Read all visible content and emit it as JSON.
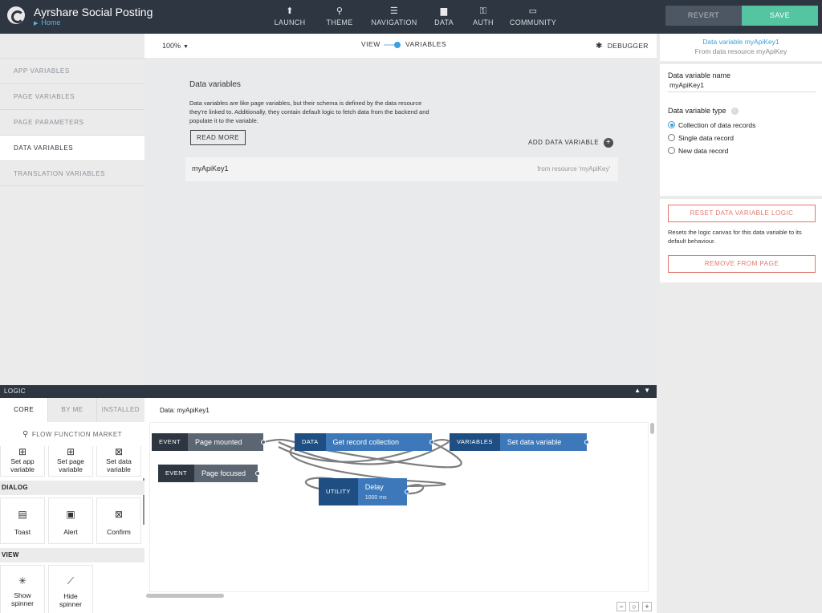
{
  "app": {
    "title": "Ayrshare Social Posting",
    "breadcrumb": "Home"
  },
  "topnav": [
    {
      "label": "LAUNCH",
      "icon": "launch-icon",
      "glyph": "⬆"
    },
    {
      "label": "THEME",
      "icon": "theme-icon",
      "glyph": "⚲"
    },
    {
      "label": "NAVIGATION",
      "icon": "navigation-icon",
      "glyph": "☰"
    },
    {
      "label": "DATA",
      "icon": "data-icon",
      "glyph": "▆"
    },
    {
      "label": "AUTH",
      "icon": "auth-icon",
      "glyph": "⚿"
    },
    {
      "label": "COMMUNITY",
      "icon": "community-icon",
      "glyph": "▭"
    }
  ],
  "actions": {
    "revert": "REVERT",
    "save": "SAVE"
  },
  "sidebar": {
    "items": [
      {
        "label": "APP VARIABLES",
        "active": false
      },
      {
        "label": "PAGE VARIABLES",
        "active": false
      },
      {
        "label": "PAGE PARAMETERS",
        "active": false
      },
      {
        "label": "DATA VARIABLES",
        "active": true
      },
      {
        "label": "TRANSLATION VARIABLES",
        "active": false
      }
    ]
  },
  "toolbar": {
    "zoom": "100%",
    "view_label": "VIEW",
    "variables_label": "VARIABLES",
    "debugger_label": "DEBUGGER"
  },
  "canvas": {
    "title": "Data variables",
    "description": "Data variables are like page variables, but their schema is defined by the data resource they're linked to. Additionally, they contain default logic to fetch data from the backend and populate it to the variable.",
    "read_more": "READ MORE",
    "add_label": "ADD DATA VARIABLE",
    "rows": [
      {
        "name": "myApiKey1",
        "source": "from resource 'myApiKey'"
      }
    ]
  },
  "properties": {
    "header_title": "Data variable myApiKey1",
    "header_sub": "From data resource myApiKey",
    "name_label": "Data variable name",
    "name_value": "myApiKey1",
    "type_label": "Data variable type",
    "type_options": [
      {
        "label": "Collection of data records",
        "selected": true
      },
      {
        "label": "Single data record",
        "selected": false
      },
      {
        "label": "New data record",
        "selected": false
      }
    ],
    "reset_label": "RESET DATA VARIABLE LOGIC",
    "reset_desc": "Resets the logic canvas for this data variable to its default behaviour.",
    "remove_label": "REMOVE FROM PAGE"
  },
  "logic": {
    "bar_title": "LOGIC",
    "tabs": [
      "CORE",
      "BY ME",
      "INSTALLED"
    ],
    "market_label": "FLOW FUNCTION MARKET",
    "variables_tiles": [
      {
        "label_1": "Set app",
        "label_2": "variable",
        "icon": "set-app-variable-icon"
      },
      {
        "label_1": "Set page",
        "label_2": "variable",
        "icon": "set-page-variable-icon"
      },
      {
        "label_1": "Set data",
        "label_2": "variable",
        "icon": "set-data-variable-icon"
      }
    ],
    "dialog_title": "DIALOG",
    "dialog_tiles": [
      {
        "label": "Toast",
        "icon": "toast-icon"
      },
      {
        "label": "Alert",
        "icon": "alert-icon"
      },
      {
        "label": "Confirm",
        "icon": "confirm-icon"
      }
    ],
    "view_title": "VIEW",
    "view_tiles": [
      {
        "label_1": "Show",
        "label_2": "spinner",
        "icon": "show-spinner-icon"
      },
      {
        "label_1": "Hide",
        "label_2": "spinner",
        "icon": "hide-spinner-icon"
      }
    ],
    "canvas_title": "Data: myApiKey1",
    "nodes": [
      {
        "type": "EVENT",
        "label": "Page mounted"
      },
      {
        "type": "DATA",
        "label": "Get record collection"
      },
      {
        "type": "VARIABLES",
        "label": "Set data variable"
      },
      {
        "type": "EVENT",
        "label": "Page focused"
      },
      {
        "type": "UTILITY",
        "label": "Delay",
        "sub": "1000 ms"
      }
    ],
    "zoom_controls": [
      "−",
      "○",
      "+"
    ]
  }
}
